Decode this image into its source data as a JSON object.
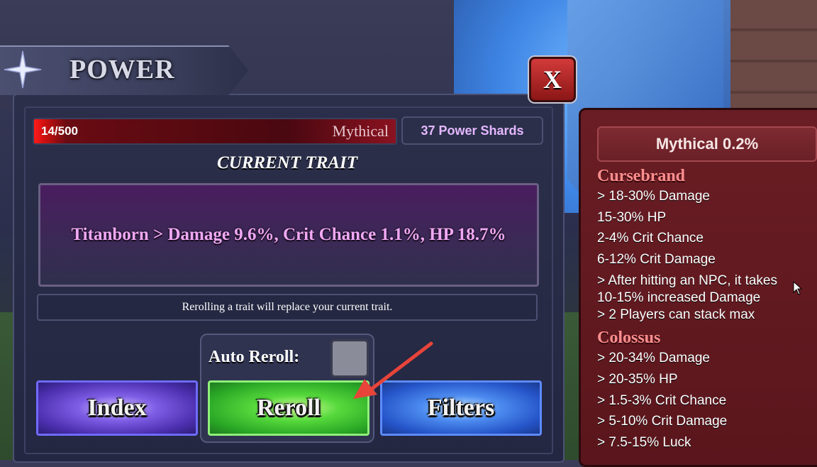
{
  "title": "POWER",
  "close_label": "X",
  "progress": {
    "count": "14/500",
    "current": 14,
    "max": 500,
    "rarity": "Mythical"
  },
  "shards": "37 Power Shards",
  "current_trait_label": "CURRENT TRAIT",
  "current_trait": "Titanborn > Damage 9.6%, Crit Chance 1.1%, HP 18.7%",
  "note": "Rerolling a trait will replace your current trait.",
  "auto_reroll": {
    "label": "Auto Reroll:",
    "checked": false
  },
  "buttons": {
    "index": "Index",
    "reroll": "Reroll",
    "filters": "Filters"
  },
  "info_panel": {
    "header": "Mythical 0.2%",
    "traits": [
      {
        "name": "Cursebrand",
        "lines": [
          "> 18-30% Damage",
          "15-30% HP",
          "2-4% Crit Chance",
          "6-12% Crit Damage",
          "> After hitting an NPC, it takes",
          "10-15% increased Damage",
          "> 2 Players can stack max"
        ]
      },
      {
        "name": "Colossus",
        "lines": [
          "> 20-34% Damage",
          "> 20-35% HP",
          "> 1.5-3% Crit Chance",
          "> 5-10% Crit Damage",
          "> 7.5-15% Luck"
        ]
      }
    ]
  },
  "colors": {
    "accent_green": "#56d93c",
    "accent_purple": "#7f5ee6",
    "accent_blue": "#4d8cf0",
    "mythical_red": "#8f0c13",
    "trait_text": "#f0a8f4"
  }
}
